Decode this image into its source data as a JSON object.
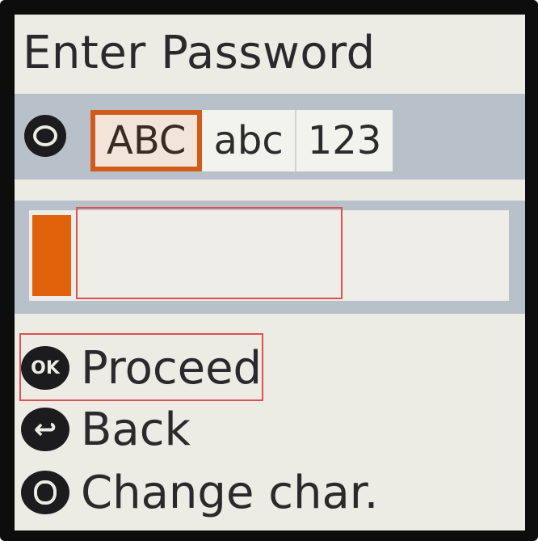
{
  "screen": {
    "title": "Enter Password"
  },
  "input_modes": {
    "icon": "mode-toggle-icon",
    "options": [
      "ABC",
      "abc",
      "123"
    ],
    "selected": "ABC"
  },
  "password": {
    "value": ""
  },
  "menu": {
    "proceed": {
      "icon_label": "OK",
      "label": "Proceed"
    },
    "back": {
      "icon": "back-arrow-icon",
      "icon_glyph": "↩",
      "label": "Back"
    },
    "change_char": {
      "icon": "change-char-icon",
      "label": "Change char."
    }
  },
  "colors": {
    "accent": "#e2620c",
    "highlight_outline": "#e05050",
    "bar": "#b8c0ca",
    "screen_bg": "#ecebe4"
  }
}
